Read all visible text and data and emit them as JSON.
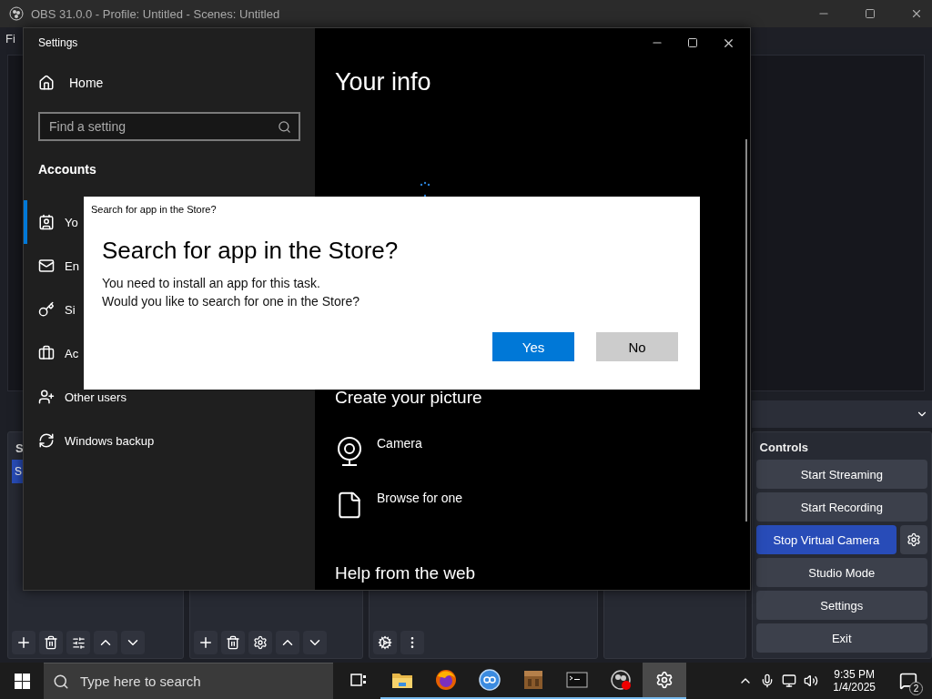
{
  "obs": {
    "title": "OBS 31.0.0 - Profile: Untitled - Scenes: Untitled",
    "menu": [
      "Fi"
    ],
    "scenes_header": "S",
    "scene_items": [
      {
        "label": "S",
        "selected": true
      }
    ],
    "controls": {
      "title": "Controls",
      "buttons": [
        {
          "label": "Start Streaming",
          "active": false,
          "gear": false
        },
        {
          "label": "Start Recording",
          "active": false,
          "gear": false
        },
        {
          "label": "Stop Virtual Camera",
          "active": true,
          "gear": true
        },
        {
          "label": "Studio Mode",
          "active": false,
          "gear": false
        },
        {
          "label": "Settings",
          "active": false,
          "gear": false
        },
        {
          "label": "Exit",
          "active": false,
          "gear": false
        }
      ]
    }
  },
  "settings": {
    "title": "Settings",
    "home": "Home",
    "search": {
      "placeholder": "Find a setting"
    },
    "section": "Accounts",
    "nav": [
      {
        "label": "Yo",
        "kind": "info",
        "selected": true
      },
      {
        "label": "En",
        "kind": "mail",
        "selected": false
      },
      {
        "label": "Si",
        "kind": "key",
        "selected": false
      },
      {
        "label": "Ac",
        "kind": "work",
        "selected": false
      },
      {
        "label": "Other users",
        "kind": "users",
        "selected": false
      },
      {
        "label": "Windows backup",
        "kind": "backup",
        "selected": false
      }
    ],
    "page": {
      "title": "Your info",
      "subheading": "Create your picture",
      "options": [
        {
          "label": "Camera",
          "kind": "camera"
        },
        {
          "label": "Browse for one",
          "kind": "file"
        }
      ],
      "footer_heading": "Help from the web"
    }
  },
  "dialog": {
    "caption": "Search for app in the Store?",
    "heading": "Search for app in the Store?",
    "lines": [
      "You need to install an app for this task.",
      "Would you like to search for one in the Store?"
    ],
    "buttons": [
      {
        "label": "Yes",
        "primary": true
      },
      {
        "label": "No",
        "primary": false
      }
    ]
  },
  "taskbar": {
    "search": {
      "placeholder": "Type here to search"
    },
    "apps": [
      {
        "kind": "taskview",
        "active": false,
        "running": false
      },
      {
        "kind": "explorer",
        "active": false,
        "running": true
      },
      {
        "kind": "firefox",
        "active": false,
        "running": true
      },
      {
        "kind": "qbittorrent",
        "active": false,
        "running": true
      },
      {
        "kind": "game",
        "active": false,
        "running": true
      },
      {
        "kind": "terminal",
        "active": false,
        "running": true
      },
      {
        "kind": "obs",
        "active": false,
        "running": true
      },
      {
        "kind": "settings",
        "active": true,
        "running": true
      }
    ],
    "time": "9:35 PM",
    "date": "1/4/2025",
    "notifications": "2"
  }
}
